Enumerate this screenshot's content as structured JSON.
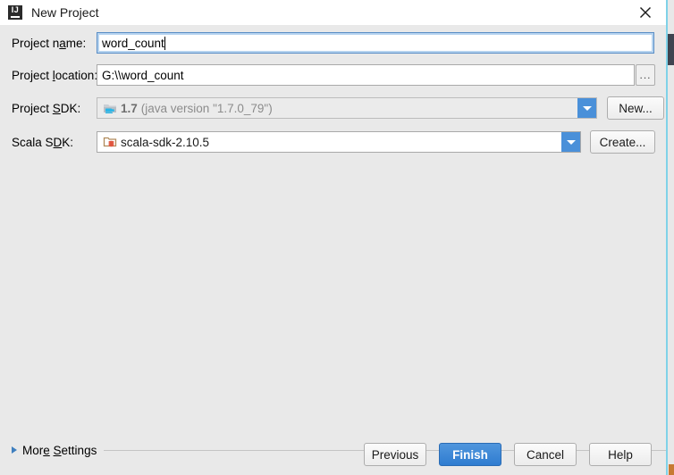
{
  "window": {
    "title": "New Project",
    "app_icon": "intellij-idea-icon",
    "icon_text": "IJ",
    "close_icon": "close-icon"
  },
  "form": {
    "project_name": {
      "label_pre": "Project n",
      "label_mnemonic": "a",
      "label_post": "me:",
      "value": "word_count"
    },
    "project_location": {
      "label_pre": "Project ",
      "label_mnemonic": "l",
      "label_post": "ocation:",
      "value": "G:\\\\word_count",
      "browse_label": "..."
    },
    "project_sdk": {
      "label_pre": "Project ",
      "label_mnemonic": "S",
      "label_post": "DK:",
      "value_main": "1.7",
      "value_sub": "(java version \"1.7.0_79\")",
      "icon": "java-sdk-folder-icon",
      "dropdown_icon": "chevron-down-icon",
      "button_label": "New..."
    },
    "scala_sdk": {
      "label_pre": "Scala S",
      "label_mnemonic": "D",
      "label_post": "K:",
      "value": "scala-sdk-2.10.5",
      "icon": "scala-sdk-folder-icon",
      "dropdown_icon": "chevron-down-icon",
      "button_label": "Create..."
    }
  },
  "more_settings": {
    "label_pre": "Mor",
    "label_mnemonic_1": "e",
    "label_mid": " ",
    "label_mnemonic_2": "S",
    "label_post": "ettings",
    "arrow_icon": "triangle-right-icon"
  },
  "footer": {
    "previous": "Previous",
    "finish": "Finish",
    "cancel": "Cancel",
    "help": "Help"
  },
  "colors": {
    "accent_blue": "#4a90d9",
    "default_button_blue": "#2f7cd0",
    "dialog_bg": "#e9e9e9",
    "titlebar_bg": "#ffffff",
    "focus_border": "#5a8ec6",
    "backdrop_edge": "#7fd2e8",
    "backdrop_dark": "#3f4450"
  }
}
